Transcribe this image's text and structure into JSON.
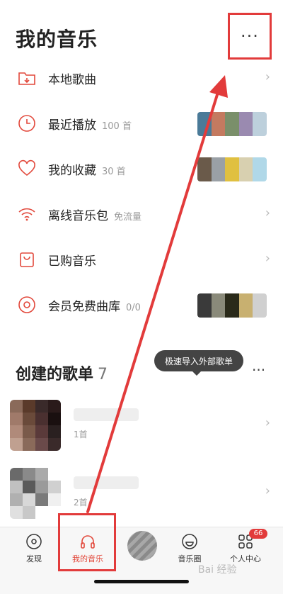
{
  "header": {
    "title": "我的音乐",
    "more_glyph": "···"
  },
  "rows": [
    {
      "label": "本地歌曲",
      "sub": "",
      "right": "chevron"
    },
    {
      "label": "最近播放",
      "sub": "100 首",
      "right": "thumbs"
    },
    {
      "label": "我的收藏",
      "sub": "30 首",
      "right": "thumbs"
    },
    {
      "label": "离线音乐包",
      "sub": "免流量",
      "right": "chevron"
    },
    {
      "label": "已购音乐",
      "sub": "",
      "right": "chevron"
    },
    {
      "label": "会员免费曲库",
      "sub": "0/0",
      "right": "thumbs"
    }
  ],
  "section": {
    "title": "创建的歌单",
    "count": "7",
    "tooltip": "极速导入外部歌单",
    "more_glyph": "···"
  },
  "playlists": [
    {
      "count": "1首"
    },
    {
      "count": "2首"
    }
  ],
  "tabs": [
    {
      "label": "发现"
    },
    {
      "label": "我的音乐"
    },
    {
      "label": ""
    },
    {
      "label": "音乐圈"
    },
    {
      "label": "个人中心"
    }
  ],
  "badge": "66",
  "watermark": "Bai 经验",
  "colors": {
    "accent": "#e2483b",
    "annotation": "#e23b3b"
  }
}
